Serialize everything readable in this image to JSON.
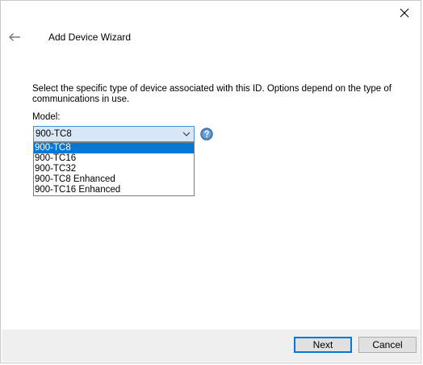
{
  "window": {
    "title": "Add Device Wizard"
  },
  "content": {
    "description": "Select the specific type of device associated with this ID. Options depend on the type of communications in use.",
    "model_label": "Model:",
    "model_selected": "900-TC8",
    "model_options": [
      "900-TC8",
      "900-TC16",
      "900-TC32",
      "900-TC8 Enhanced",
      "900-TC16 Enhanced"
    ]
  },
  "footer": {
    "next_label": "Next",
    "cancel_label": "Cancel"
  },
  "colors": {
    "selection": "#0078d7",
    "select_bg": "#d9e8f6",
    "footer_bg": "#f0f0f0"
  },
  "icons": {
    "close": "close-icon",
    "back": "back-arrow-icon",
    "help": "help-icon",
    "dropdown": "chevron-down-icon"
  }
}
